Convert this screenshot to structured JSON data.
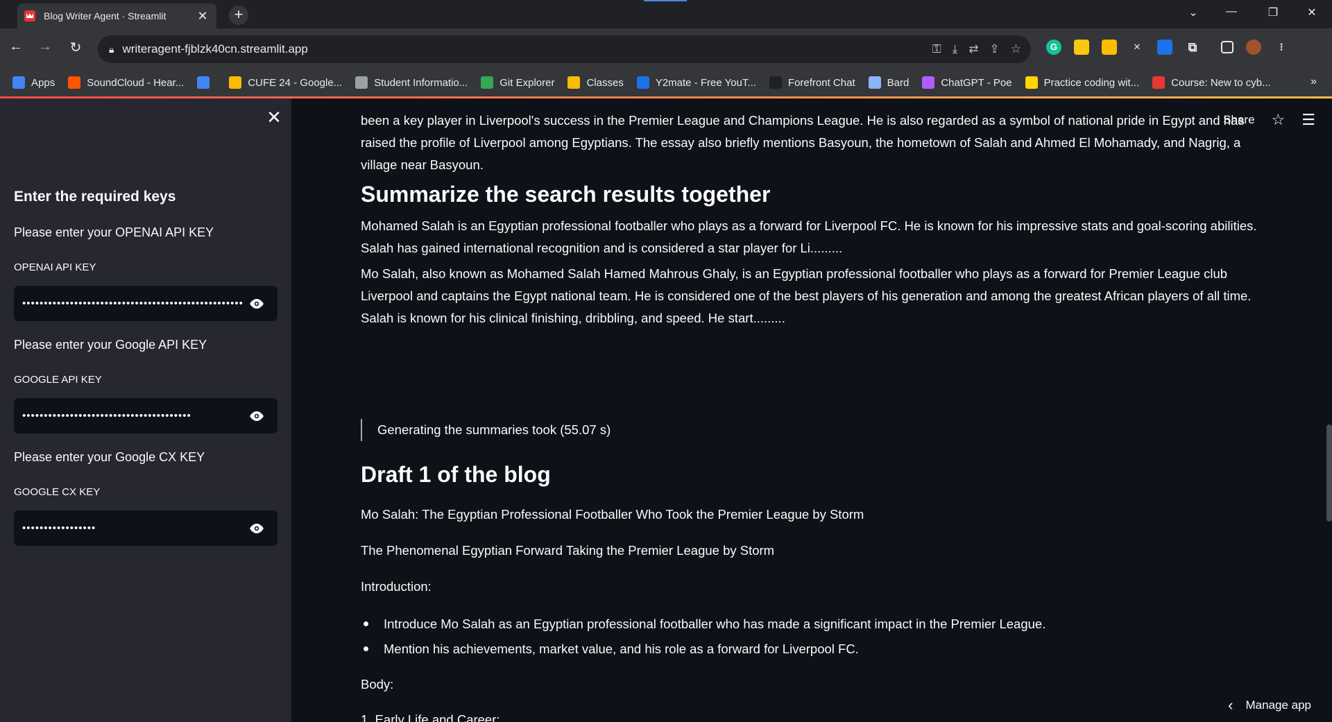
{
  "browser": {
    "tab_title": "Blog Writer Agent · Streamlit",
    "url": "writeragent-fjblzk40cn.streamlit.app",
    "bookmarks": [
      {
        "label": "Apps",
        "color": "#4285f4"
      },
      {
        "label": "SoundCloud - Hear...",
        "color": "#ff5500"
      },
      {
        "label": "",
        "color": "#4285f4"
      },
      {
        "label": "CUFE 24 - Google...",
        "color": "#fbbc04"
      },
      {
        "label": "Student Informatio...",
        "color": "#9aa0a6"
      },
      {
        "label": "Git Explorer",
        "color": "#34a853"
      },
      {
        "label": "Classes",
        "color": "#fbbc04"
      },
      {
        "label": "Y2mate - Free YouT...",
        "color": "#1a73e8"
      },
      {
        "label": "Forefront Chat",
        "color": "#202124"
      },
      {
        "label": "Bard",
        "color": "#8ab4f8"
      },
      {
        "label": "ChatGPT - Poe",
        "color": "#b15dff"
      },
      {
        "label": "Practice coding wit...",
        "color": "#ffd600"
      },
      {
        "label": "Course: New to cyb...",
        "color": "#e53935"
      }
    ]
  },
  "sidebar": {
    "heading": "Enter the required keys",
    "openai_prompt": "Please enter your OPENAI API KEY",
    "openai_label": "OPENAI API KEY",
    "openai_value": "••••••••••••••••••••••••••••••••••••••••••••••••••••",
    "google_prompt": "Please enter your Google API KEY",
    "google_label": "GOOGLE API KEY",
    "google_value": "•••••••••••••••••••••••••••••••••••••••",
    "cx_prompt": "Please enter your Google CX KEY",
    "cx_label": "GOOGLE CX KEY",
    "cx_value": "•••••••••••••••••"
  },
  "header": {
    "share": "Share"
  },
  "main": {
    "intro_para": "been a key player in Liverpool's success in the Premier League and Champions League. He is also regarded as a symbol of national pride in Egypt and has raised the profile of Liverpool among Egyptians. The essay also briefly mentions Basyoun, the hometown of Salah and Ahmed El Mohamady, and Nagrig, a village near Basyoun.",
    "summary_heading": "Summarize the search results together",
    "summary_para1": "Mohamed Salah is an Egyptian professional footballer who plays as a forward for Liverpool FC. He is known for his impressive stats and goal-scoring abilities. Salah has gained international recognition and is considered a star player for Li.........",
    "summary_para2": "Mo Salah, also known as Mohamed Salah Hamed Mahrous Ghaly, is an Egyptian professional footballer who plays as a forward for Premier League club Liverpool and captains the Egypt national team. He is considered one of the best players of his generation and among the greatest African players of all time. Salah is known for his clinical finishing, dribbling, and speed. He start.........",
    "timing_quote": "Generating the summaries took (55.07 s)",
    "draft_heading": "Draft 1 of the blog",
    "draft_title": "Mo Salah: The Egyptian Professional Footballer Who Took the Premier League by Storm",
    "draft_subtitle": "The Phenomenal Egyptian Forward Taking the Premier League by Storm",
    "intro_label": "Introduction:",
    "bullets": [
      "Introduce Mo Salah as an Egyptian professional footballer who has made a significant impact in the Premier League.",
      "Mention his achievements, market value, and his role as a forward for Liverpool FC."
    ],
    "body_label": "Body:",
    "list_item_1": "1.   Early Life and Career:"
  },
  "footer": {
    "manage_app": "Manage app"
  }
}
